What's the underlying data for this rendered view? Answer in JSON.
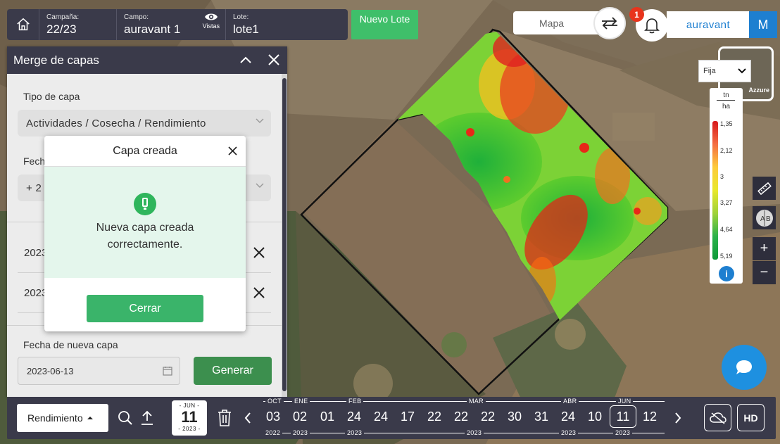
{
  "topbar": {
    "campania_label": "Campaña:",
    "campania_value": "22/23",
    "campo_label": "Campo:",
    "campo_value": "auravant 1",
    "vistas_label": "Vistas",
    "lote_label": "Lote:",
    "lote_value": "lote1",
    "nuevo_lote": "Nuevo Lote"
  },
  "header_right": {
    "mapa_label": "Mapa",
    "notification_count": "1",
    "brand": "auravant",
    "avatar_letter": "M"
  },
  "layer": {
    "thumb_label": "Azzure",
    "mode_select": "Fija"
  },
  "legend": {
    "unit_top": "tn",
    "unit_bottom": "ha",
    "ticks": [
      "1,35",
      "2,12",
      "3",
      "3,27",
      "4,64",
      "5,19"
    ],
    "info_symbol": "i"
  },
  "tools": {
    "zoom_in": "+",
    "zoom_out": "−"
  },
  "panel": {
    "title": "Merge de capas",
    "tipo_label": "Tipo de capa",
    "tipo_value": "Actividades / Cosecha / Rendimiento",
    "fecha_label": "Fecha",
    "fecha_select_value": "+ 2",
    "rows": [
      {
        "text": "2023"
      },
      {
        "text": "2023"
      }
    ],
    "nueva_fecha_label": "Fecha de nueva capa",
    "nueva_fecha_value": "2023-06-13",
    "generar": "Generar"
  },
  "modal": {
    "title": "Capa creada",
    "message_line1": "Nueva capa creada",
    "message_line2": "correctamente.",
    "close_button": "Cerrar"
  },
  "bottombar": {
    "layer_button": "Rendimiento",
    "current_date": {
      "month": "JUN",
      "day": "11",
      "year": "2023"
    },
    "timeline_days": [
      "03",
      "02",
      "01",
      "24",
      "24",
      "17",
      "22",
      "22",
      "22",
      "30",
      "31",
      "24",
      "10",
      "11",
      "12"
    ],
    "selected_day_index": 13,
    "months": [
      "OCT",
      "ENE",
      "FEB",
      "MAR",
      "ABR",
      "JUN"
    ],
    "years": [
      "2022",
      "2023",
      "2023",
      "2023",
      "2023",
      "2023"
    ],
    "hd_label": "HD"
  },
  "colors": {
    "dark_bar": "#3a3a4a",
    "green_primary": "#3fbf6a",
    "brand_blue": "#1e7fd0",
    "badge_red": "#e8341c"
  }
}
